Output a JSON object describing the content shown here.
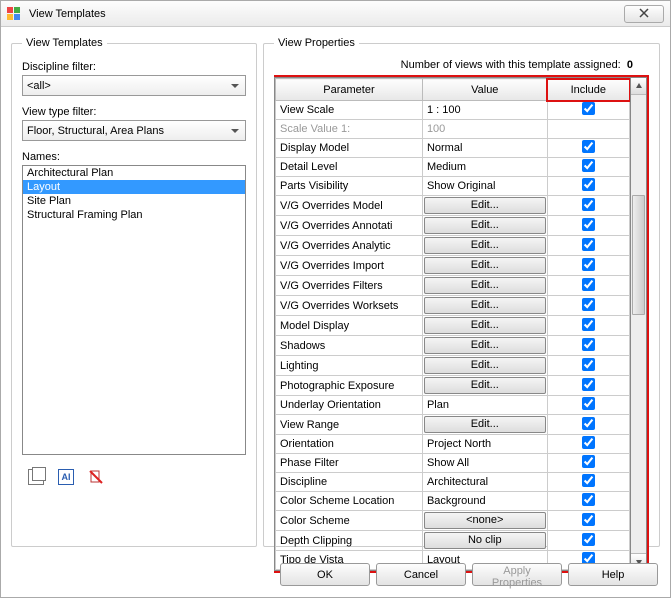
{
  "window": {
    "title": "View Templates",
    "close_glyph": "×"
  },
  "left": {
    "legend": "View Templates",
    "discipline_label": "Discipline filter:",
    "discipline_value": "<all>",
    "viewtype_label": "View type filter:",
    "viewtype_value": "Floor, Structural, Area Plans",
    "names_label": "Names:",
    "names": [
      "Architectural Plan",
      "Layout",
      "Site Plan",
      "Structural Framing Plan"
    ],
    "selected_index": 1,
    "rename_text": "AI"
  },
  "right": {
    "legend": "View Properties",
    "assigned_label": "Number of views with this template assigned:",
    "assigned_value": "0",
    "headers": {
      "param": "Parameter",
      "value": "Value",
      "include": "Include"
    },
    "rows": [
      {
        "p": "View Scale",
        "v": "1 : 100",
        "t": "text",
        "inc": true,
        "dis": false
      },
      {
        "p": "Scale Value    1:",
        "v": "100",
        "t": "text",
        "inc": false,
        "dis": true
      },
      {
        "p": "Display Model",
        "v": "Normal",
        "t": "text",
        "inc": true,
        "dis": false
      },
      {
        "p": "Detail Level",
        "v": "Medium",
        "t": "text",
        "inc": true,
        "dis": false
      },
      {
        "p": "Parts Visibility",
        "v": "Show Original",
        "t": "text",
        "inc": true,
        "dis": false
      },
      {
        "p": "V/G Overrides Model",
        "v": "Edit...",
        "t": "btn",
        "inc": true,
        "dis": false
      },
      {
        "p": "V/G Overrides Annotati",
        "v": "Edit...",
        "t": "btn",
        "inc": true,
        "dis": false
      },
      {
        "p": "V/G Overrides Analytic",
        "v": "Edit...",
        "t": "btn",
        "inc": true,
        "dis": false
      },
      {
        "p": "V/G Overrides Import",
        "v": "Edit...",
        "t": "btn",
        "inc": true,
        "dis": false
      },
      {
        "p": "V/G Overrides Filters",
        "v": "Edit...",
        "t": "btn",
        "inc": true,
        "dis": false
      },
      {
        "p": "V/G Overrides Worksets",
        "v": "Edit...",
        "t": "btn",
        "inc": true,
        "dis": false
      },
      {
        "p": "Model Display",
        "v": "Edit...",
        "t": "btn",
        "inc": true,
        "dis": false
      },
      {
        "p": "Shadows",
        "v": "Edit...",
        "t": "btn",
        "inc": true,
        "dis": false
      },
      {
        "p": "Lighting",
        "v": "Edit...",
        "t": "btn",
        "inc": true,
        "dis": false
      },
      {
        "p": "Photographic Exposure",
        "v": "Edit...",
        "t": "btn",
        "inc": true,
        "dis": false
      },
      {
        "p": "Underlay Orientation",
        "v": "Plan",
        "t": "text",
        "inc": true,
        "dis": false
      },
      {
        "p": "View Range",
        "v": "Edit...",
        "t": "btn",
        "inc": true,
        "dis": false
      },
      {
        "p": "Orientation",
        "v": "Project North",
        "t": "text",
        "inc": true,
        "dis": false
      },
      {
        "p": "Phase Filter",
        "v": "Show All",
        "t": "text",
        "inc": true,
        "dis": false
      },
      {
        "p": "Discipline",
        "v": "Architectural",
        "t": "text",
        "inc": true,
        "dis": false
      },
      {
        "p": "Color Scheme Location",
        "v": "Background",
        "t": "text",
        "inc": true,
        "dis": false
      },
      {
        "p": "Color Scheme",
        "v": "<none>",
        "t": "btn",
        "inc": true,
        "dis": false
      },
      {
        "p": "Depth Clipping",
        "v": "No clip",
        "t": "btn",
        "inc": true,
        "dis": false
      },
      {
        "p": "Tipo de Vista",
        "v": "Layout",
        "t": "text",
        "inc": true,
        "dis": false
      }
    ]
  },
  "buttons": {
    "ok": "OK",
    "cancel": "Cancel",
    "apply": "Apply Properties",
    "help": "Help"
  }
}
